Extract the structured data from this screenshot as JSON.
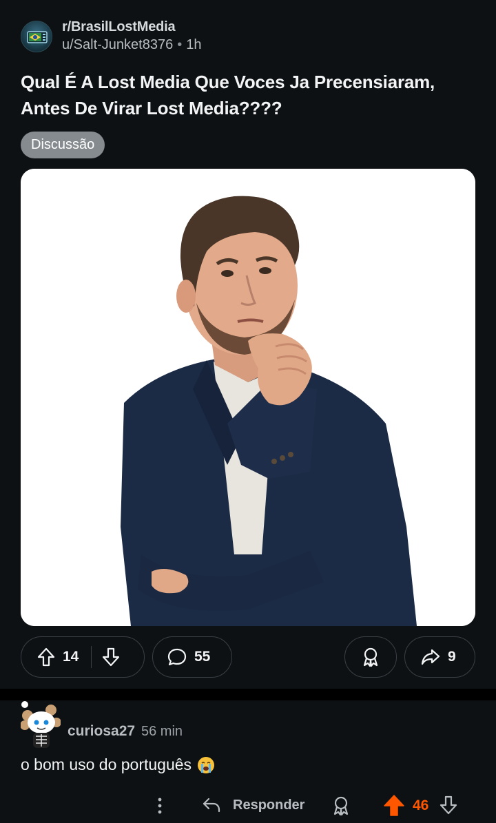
{
  "post": {
    "subreddit": "r/BrasilLostMedia",
    "author": "u/Salt-Junket8376",
    "time": "1h",
    "title": "Qual É A Lost Media Que Voces Ja Precensiaram, Antes De Virar Lost Media????",
    "flair": "Discussão",
    "image_icon": "thinking-man-photo",
    "upvotes": "14",
    "comments": "55",
    "shares": "9"
  },
  "comment": {
    "author": "curiosa27",
    "time": "56 min",
    "body": "o bom uso do português",
    "emoji_icon": "loudly-crying-face-icon",
    "reply_label": "Responder",
    "score": "46"
  },
  "colors": {
    "background": "#0e1113",
    "upvoted": "#ff5700",
    "flair": "#868b8f"
  }
}
